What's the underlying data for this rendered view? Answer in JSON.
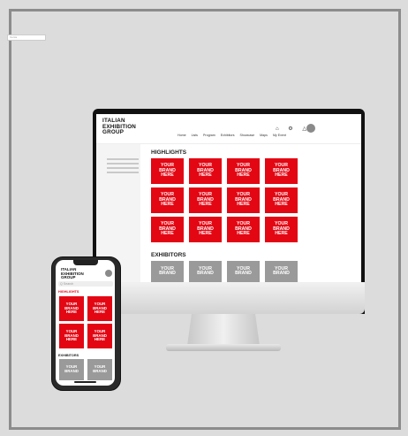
{
  "desktop": {
    "logo_lines": [
      "ITALIAN",
      "EXHIBITION",
      "GROUP"
    ],
    "nav_items": [
      "Home",
      "Lists",
      "Program",
      "Exhibitors",
      "Showcase",
      "Maps",
      "My Event"
    ],
    "search_placeholder": "Cerca",
    "sidebar_items": [
      "",
      "",
      "",
      ""
    ],
    "highlights_title": "HIGHLIGHTS",
    "exhibitors_title": "EXHIBITORS",
    "highlight_tiles": [
      "YOUR BRAND HERE",
      "YOUR BRAND HERE",
      "YOUR BRAND HERE",
      "YOUR BRAND HERE",
      "YOUR BRAND HERE",
      "YOUR BRAND HERE",
      "YOUR BRAND HERE",
      "YOUR BRAND HERE",
      "YOUR BRAND HERE",
      "YOUR BRAND HERE",
      "YOUR BRAND HERE",
      "YOUR BRAND HERE"
    ],
    "exhibitor_tiles": [
      "YOUR BRAND",
      "YOUR BRAND",
      "YOUR BRAND",
      "YOUR BRAND"
    ]
  },
  "mobile": {
    "time": "12:4",
    "logo_lines": [
      "ITALIAN",
      "EXHIBITION",
      "GROUP"
    ],
    "search_placeholder": "Q Search",
    "highlights_title": "HIGHLIGHTS",
    "exhibitors_title": "EXHIBITORS",
    "highlight_tiles": [
      "YOUR BRAND HERE",
      "YOUR BRAND HERE",
      "YOUR BRAND HERE",
      "YOUR BRAND HERE"
    ],
    "exhibitor_tiles": [
      "YOUR BRAND",
      "YOUR BRAND"
    ]
  },
  "colors": {
    "brand_red": "#e30613",
    "tile_gray": "#9a9a9a",
    "background": "#dcdcdc"
  }
}
